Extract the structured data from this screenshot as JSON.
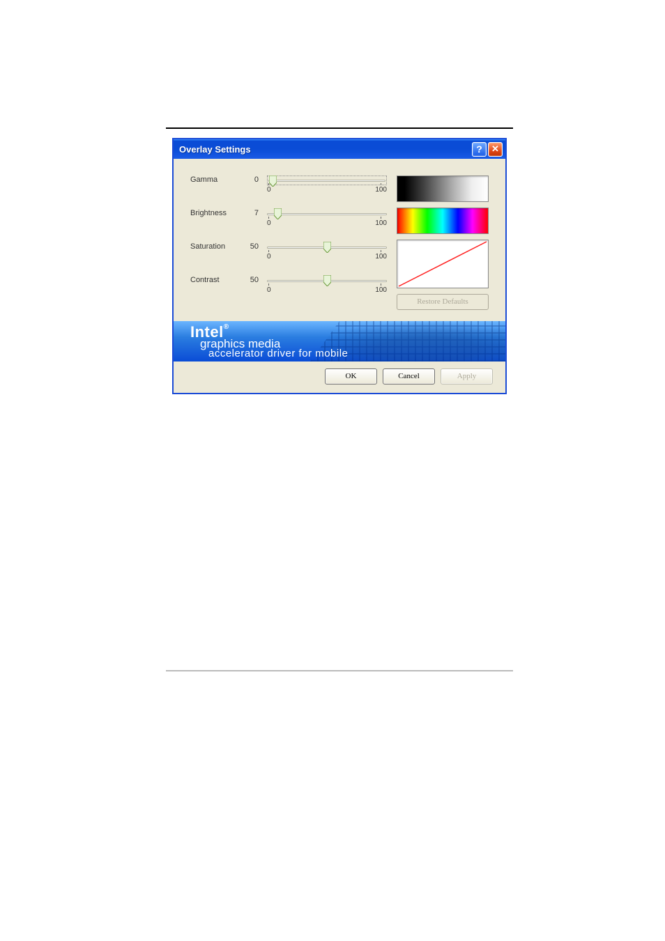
{
  "title": "Overlay Settings",
  "sliders": {
    "gamma": {
      "label": "Gamma",
      "value": "0",
      "min": "0",
      "max": "100",
      "pos": 0
    },
    "brightness": {
      "label": "Brightness",
      "value": "7",
      "min": "0",
      "max": "100",
      "pos": 7
    },
    "saturation": {
      "label": "Saturation",
      "value": "50",
      "min": "0",
      "max": "100",
      "pos": 50
    },
    "contrast": {
      "label": "Contrast",
      "value": "50",
      "min": "0",
      "max": "100",
      "pos": 50
    }
  },
  "buttons": {
    "restore_defaults": "Restore Defaults",
    "ok": "OK",
    "cancel": "Cancel",
    "apply": "Apply"
  },
  "banner": {
    "brand": "Intel",
    "line2": "graphics media",
    "line3": "accelerator driver for mobile"
  }
}
